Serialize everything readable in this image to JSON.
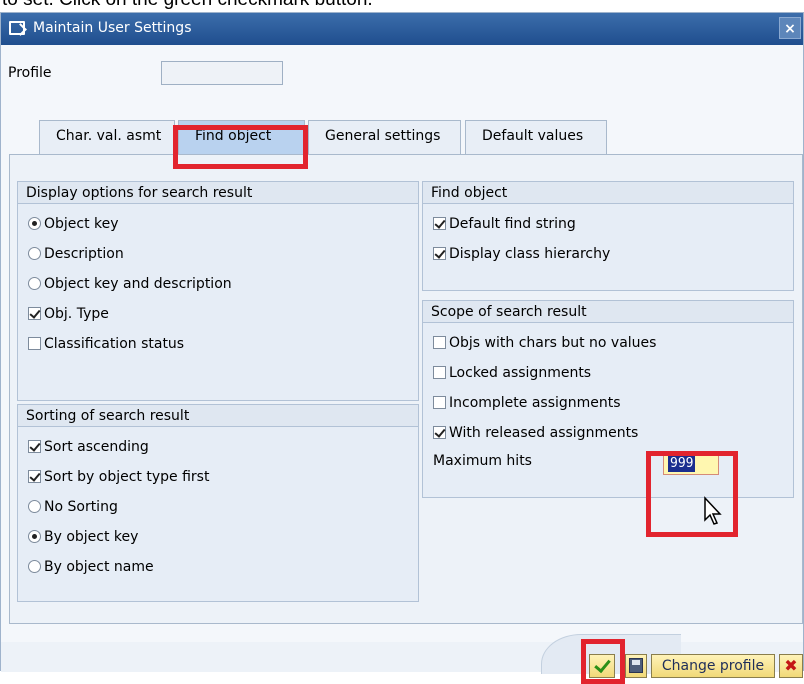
{
  "caption": "to set. Click on the green checkmark button.",
  "window": {
    "title": "Maintain User Settings",
    "close_symbol": "×"
  },
  "profile": {
    "label": "Profile",
    "value": ""
  },
  "tabs": [
    {
      "label": "Char. val. asmt"
    },
    {
      "label": "Find object"
    },
    {
      "label": "General settings"
    },
    {
      "label": "Default values"
    }
  ],
  "active_tab": "Find object",
  "display_options": {
    "title": "Display options for search result",
    "items": [
      {
        "label": "Object key",
        "type": "radio",
        "checked": true
      },
      {
        "label": "Description",
        "type": "radio",
        "checked": false
      },
      {
        "label": "Object key and description",
        "type": "radio",
        "checked": false
      },
      {
        "label": "Obj. Type",
        "type": "checkbox",
        "checked": true
      },
      {
        "label": "Classification status",
        "type": "checkbox",
        "checked": false
      }
    ]
  },
  "sorting": {
    "title": "Sorting of search result",
    "items": [
      {
        "label": "Sort ascending",
        "type": "checkbox",
        "checked": true
      },
      {
        "label": "Sort by object type first",
        "type": "checkbox",
        "checked": true
      },
      {
        "label": "No Sorting",
        "type": "radio",
        "checked": false
      },
      {
        "label": "By object key",
        "type": "radio",
        "checked": true
      },
      {
        "label": "By object name",
        "type": "radio",
        "checked": false
      }
    ]
  },
  "find_object": {
    "title": "Find object",
    "items": [
      {
        "label": "Default find string",
        "type": "checkbox",
        "checked": true
      },
      {
        "label": "Display class hierarchy",
        "type": "checkbox",
        "checked": true
      }
    ]
  },
  "scope": {
    "title": "Scope of search result",
    "items": [
      {
        "label": "Objs with chars but no values",
        "type": "checkbox",
        "checked": false
      },
      {
        "label": "Locked assignments",
        "type": "checkbox",
        "checked": false
      },
      {
        "label": "Incomplete assignments",
        "type": "checkbox",
        "checked": false
      },
      {
        "label": "With released assignments",
        "type": "checkbox",
        "checked": true
      }
    ],
    "max_hits_label": "Maximum hits",
    "max_hits_value": "999"
  },
  "footer": {
    "change_profile_label": "Change profile",
    "cancel_symbol": "✖"
  },
  "colors": {
    "title_bar": "#1f4e8e",
    "highlight": "#e2242e",
    "confirm_green": "#2a8f18",
    "active_tab": "#b9d2ef"
  }
}
